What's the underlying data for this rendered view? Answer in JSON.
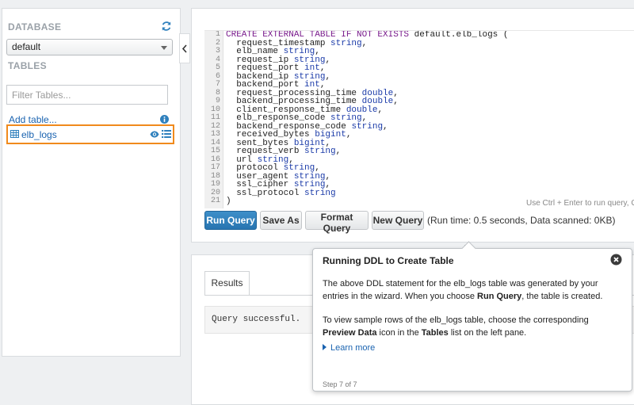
{
  "sidebar": {
    "database_label": "DATABASE",
    "database_selected": "default",
    "tables_label": "TABLES",
    "filter_placeholder": "Filter Tables...",
    "add_table_label": "Add table...",
    "tables": [
      {
        "name": "elb_logs"
      }
    ]
  },
  "editor": {
    "lines": [
      {
        "n": "1",
        "kw": "CREATE EXTERNAL TABLE IF NOT EXISTS",
        "rest": " default.elb_logs (",
        "ty": "",
        "end": ""
      },
      {
        "n": "2",
        "kw": "",
        "rest": "  request_timestamp ",
        "ty": "string",
        "end": ","
      },
      {
        "n": "3",
        "kw": "",
        "rest": "  elb_name ",
        "ty": "string",
        "end": ","
      },
      {
        "n": "4",
        "kw": "",
        "rest": "  request_ip ",
        "ty": "string",
        "end": ","
      },
      {
        "n": "5",
        "kw": "",
        "rest": "  request_port ",
        "ty": "int",
        "end": ","
      },
      {
        "n": "6",
        "kw": "",
        "rest": "  backend_ip ",
        "ty": "string",
        "end": ","
      },
      {
        "n": "7",
        "kw": "",
        "rest": "  backend_port ",
        "ty": "int",
        "end": ","
      },
      {
        "n": "8",
        "kw": "",
        "rest": "  request_processing_time ",
        "ty": "double",
        "end": ","
      },
      {
        "n": "9",
        "kw": "",
        "rest": "  backend_processing_time ",
        "ty": "double",
        "end": ","
      },
      {
        "n": "10",
        "kw": "",
        "rest": "  client_response_time ",
        "ty": "double",
        "end": ","
      },
      {
        "n": "11",
        "kw": "",
        "rest": "  elb_response_code ",
        "ty": "string",
        "end": ","
      },
      {
        "n": "12",
        "kw": "",
        "rest": "  backend_response_code ",
        "ty": "string",
        "end": ","
      },
      {
        "n": "13",
        "kw": "",
        "rest": "  received_bytes ",
        "ty": "bigint",
        "end": ","
      },
      {
        "n": "14",
        "kw": "",
        "rest": "  sent_bytes ",
        "ty": "bigint",
        "end": ","
      },
      {
        "n": "15",
        "kw": "",
        "rest": "  request_verb ",
        "ty": "string",
        "end": ","
      },
      {
        "n": "16",
        "kw": "",
        "rest": "  url ",
        "ty": "string",
        "end": ","
      },
      {
        "n": "17",
        "kw": "",
        "rest": "  protocol ",
        "ty": "string",
        "end": ","
      },
      {
        "n": "18",
        "kw": "",
        "rest": "  user_agent ",
        "ty": "string",
        "end": ","
      },
      {
        "n": "19",
        "kw": "",
        "rest": "  ssl_cipher ",
        "ty": "string",
        "end": ","
      },
      {
        "n": "20",
        "kw": "",
        "rest": "  ssl_protocol ",
        "ty": "string",
        "end": ""
      },
      {
        "n": "21",
        "kw": "",
        "rest": ")",
        "ty": "",
        "end": ""
      }
    ],
    "hint": "Use Ctrl + Enter to run query, Ctr",
    "buttons": {
      "run": "Run Query",
      "save_as": "Save As",
      "format": "Format Query",
      "new": "New Query"
    },
    "run_info": "(Run time: 0.5 seconds, Data scanned: 0KB)"
  },
  "results": {
    "tab_label": "Results",
    "message": "Query successful."
  },
  "popover": {
    "title": "Running DDL to Create Table",
    "para1_a": "The above DDL statement for the elb_logs table was generated by your entries in the wizard. When you choose ",
    "para1_b": "Run Query",
    "para1_c": ", the table is created.",
    "para2_a": "To view sample rows of the elb_logs table, choose the corresponding ",
    "para2_b": "Preview Data",
    "para2_c": " icon in the ",
    "para2_d": "Tables",
    "para2_e": " list on the left pane.",
    "learn_more": "Learn more",
    "step": "Step 7 of 7"
  },
  "colors": {
    "accent_blue": "#2f80bd",
    "link_blue": "#1a63b0",
    "highlight_orange": "#f08a1c"
  }
}
